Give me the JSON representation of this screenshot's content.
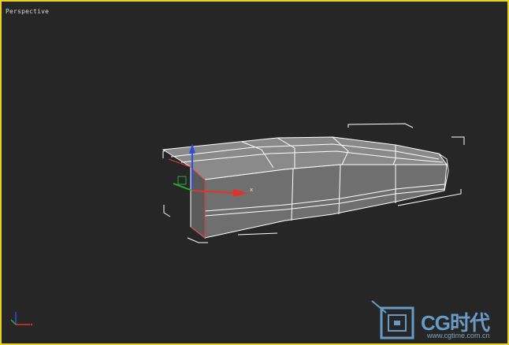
{
  "viewport": {
    "label": "Perspective",
    "border_color": "#e8d21f",
    "background": "#262626"
  },
  "model": {
    "surface_color": "#6f6f6f",
    "top_color": "#8a8a8a",
    "edge_color": "#ffffff",
    "bbox_color": "#ffffff",
    "selected_edge_color": "#e03a3a"
  },
  "gizmo": {
    "x_label": "x",
    "x_color": "#e8302a",
    "y_color": "#2fa82f",
    "z_color": "#2f4fe0"
  },
  "axis_tripod": {
    "x_color": "#e8302a",
    "y_color": "#2fa82f",
    "z_color": "#2f4fe0"
  },
  "watermark": {
    "logo_icon": "cg-logo-icon",
    "text": "CG时代",
    "subtext": "www.cgtime.com.cn",
    "color": "#6fa8d8"
  }
}
